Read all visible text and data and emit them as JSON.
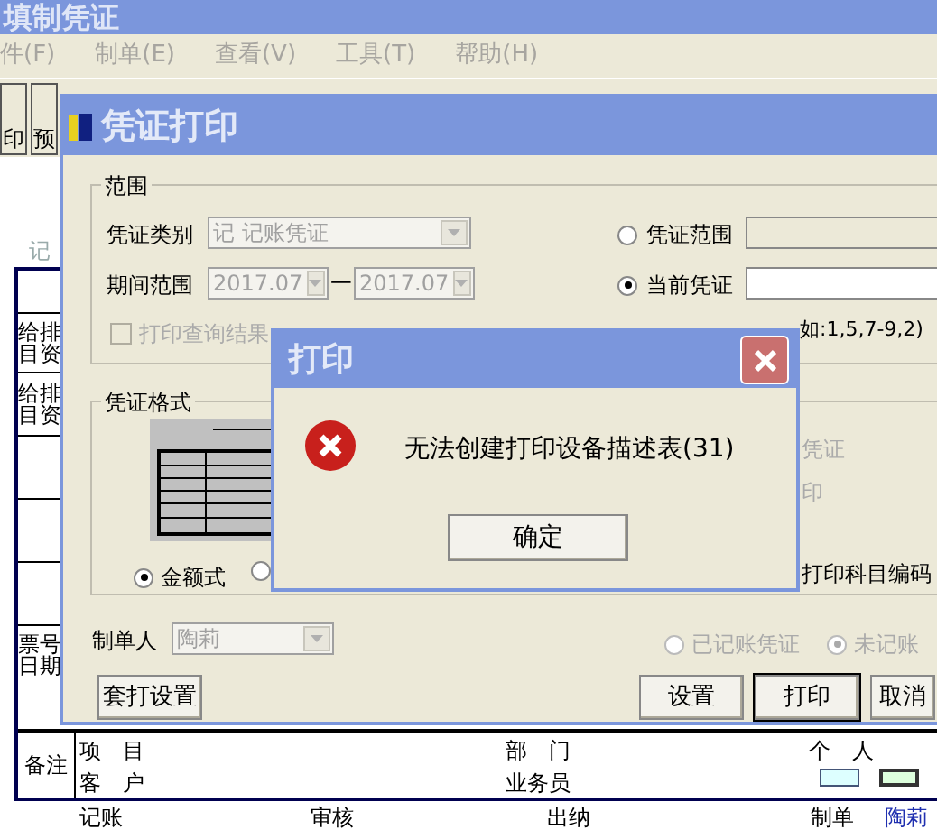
{
  "main_window": {
    "title": "填制凭证",
    "menu": [
      "件(F)",
      "制单(E)",
      "查看(V)",
      "工具(T)",
      "帮助(H)"
    ],
    "toolbar": [
      "印",
      "预"
    ],
    "voucher": {
      "type_mark": "记",
      "left_cells": [
        [
          "给排",
          "目资"
        ],
        [
          "给排",
          "目资"
        ],
        [],
        [],
        [],
        [
          "票号",
          "日期"
        ]
      ],
      "remark_label": "备注",
      "remark_fields": [
        "项　目",
        "客　户",
        "部　门",
        "业务员",
        "个　人"
      ],
      "footer": [
        "记账",
        "审核",
        "出纳",
        "制单",
        "陶莉"
      ]
    }
  },
  "print_dialog": {
    "title": "凭证打印",
    "range_group": {
      "label": "范围",
      "category_label": "凭证类别",
      "category_value": "记 记账凭证",
      "period_label": "期间范围",
      "period_from": "2017.07",
      "period_separator": "一",
      "period_to": "2017.07",
      "query_checkbox": {
        "label": "打印查询结果",
        "checked": false,
        "disabled": true
      },
      "range_options": [
        {
          "label": "凭证范围",
          "selected": false
        },
        {
          "label": "当前凭证",
          "selected": true
        }
      ],
      "range_hint": "如:1,5,7-9,2)"
    },
    "format_group": {
      "label": "凭证格式",
      "formats": [
        {
          "label": "金额式",
          "selected": true
        },
        {
          "selected": false
        }
      ],
      "right_texts": [
        "凭证",
        "印",
        "打印科目编码"
      ]
    },
    "maker_label": "制单人",
    "maker_value": "陶莉",
    "status_options": [
      {
        "label": "已记账凭证",
        "selected": false
      },
      {
        "label": "未记账",
        "selected": true
      }
    ],
    "buttons": [
      {
        "label": "套打设置",
        "default": false
      },
      {
        "label": "设置",
        "default": false
      },
      {
        "label": "打印",
        "default": true
      },
      {
        "label": "取消",
        "default": false
      }
    ]
  },
  "error_dialog": {
    "title": "打印",
    "message": "无法创建打印设备描述表(31)",
    "button": "确定"
  }
}
